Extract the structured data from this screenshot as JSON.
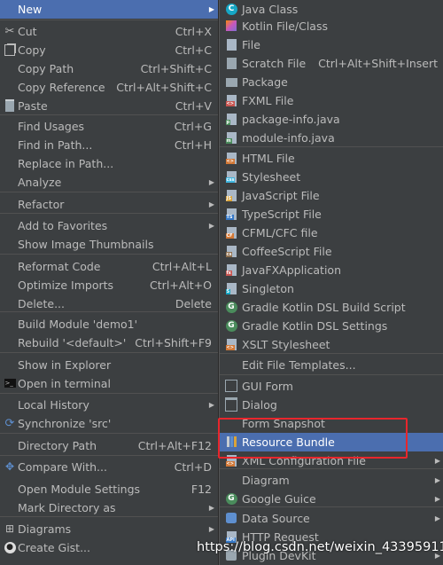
{
  "left_menu": {
    "items": [
      {
        "label": "New",
        "shortcut": "",
        "submenu": true,
        "icon": "",
        "selected": true
      },
      {
        "label": "Cut",
        "shortcut": "Ctrl+X",
        "submenu": false,
        "icon": "scissors-icon"
      },
      {
        "label": "Copy",
        "shortcut": "Ctrl+C",
        "submenu": false,
        "icon": "copy-icon"
      },
      {
        "label": "Copy Path",
        "shortcut": "Ctrl+Shift+C",
        "submenu": false,
        "icon": ""
      },
      {
        "label": "Copy Reference",
        "shortcut": "Ctrl+Alt+Shift+C",
        "submenu": false,
        "icon": ""
      },
      {
        "label": "Paste",
        "shortcut": "Ctrl+V",
        "submenu": false,
        "icon": "paste-icon"
      },
      {
        "label": "Find Usages",
        "shortcut": "Ctrl+G",
        "submenu": false,
        "icon": ""
      },
      {
        "label": "Find in Path...",
        "shortcut": "Ctrl+H",
        "submenu": false,
        "icon": ""
      },
      {
        "label": "Replace in Path...",
        "shortcut": "",
        "submenu": false,
        "icon": ""
      },
      {
        "label": "Analyze",
        "shortcut": "",
        "submenu": true,
        "icon": ""
      },
      {
        "label": "Refactor",
        "shortcut": "",
        "submenu": true,
        "icon": ""
      },
      {
        "label": "Add to Favorites",
        "shortcut": "",
        "submenu": true,
        "icon": ""
      },
      {
        "label": "Show Image Thumbnails",
        "shortcut": "",
        "submenu": false,
        "icon": ""
      },
      {
        "label": "Reformat Code",
        "shortcut": "Ctrl+Alt+L",
        "submenu": false,
        "icon": ""
      },
      {
        "label": "Optimize Imports",
        "shortcut": "Ctrl+Alt+O",
        "submenu": false,
        "icon": ""
      },
      {
        "label": "Delete...",
        "shortcut": "Delete",
        "submenu": false,
        "icon": ""
      },
      {
        "label": "Build Module 'demo1'",
        "shortcut": "",
        "submenu": false,
        "icon": ""
      },
      {
        "label": "Rebuild '<default>'",
        "shortcut": "Ctrl+Shift+F9",
        "submenu": false,
        "icon": ""
      },
      {
        "label": "Show in Explorer",
        "shortcut": "",
        "submenu": false,
        "icon": ""
      },
      {
        "label": "Open in terminal",
        "shortcut": "",
        "submenu": false,
        "icon": "terminal-icon"
      },
      {
        "label": "Local History",
        "shortcut": "",
        "submenu": true,
        "icon": ""
      },
      {
        "label": "Synchronize 'src'",
        "shortcut": "",
        "submenu": false,
        "icon": "sync-icon"
      },
      {
        "label": "Directory Path",
        "shortcut": "Ctrl+Alt+F12",
        "submenu": false,
        "icon": ""
      },
      {
        "label": "Compare With...",
        "shortcut": "Ctrl+D",
        "submenu": false,
        "icon": "compare-icon"
      },
      {
        "label": "Open Module Settings",
        "shortcut": "F12",
        "submenu": false,
        "icon": ""
      },
      {
        "label": "Mark Directory as",
        "shortcut": "",
        "submenu": true,
        "icon": ""
      },
      {
        "label": "Diagrams",
        "shortcut": "",
        "submenu": true,
        "icon": "diagrams-icon"
      },
      {
        "label": "Create Gist...",
        "shortcut": "",
        "submenu": false,
        "icon": "github-icon"
      }
    ]
  },
  "right_menu": {
    "items": [
      {
        "label": "Java Class",
        "shortcut": "",
        "submenu": false,
        "icon": "java-class-icon"
      },
      {
        "label": "Kotlin File/Class",
        "shortcut": "",
        "submenu": false,
        "icon": "kotlin-file-icon"
      },
      {
        "label": "File",
        "shortcut": "",
        "submenu": false,
        "icon": "file-icon"
      },
      {
        "label": "Scratch File",
        "shortcut": "Ctrl+Alt+Shift+Insert",
        "submenu": false,
        "icon": "scratch-file-icon"
      },
      {
        "label": "Package",
        "shortcut": "",
        "submenu": false,
        "icon": "package-icon"
      },
      {
        "label": "FXML File",
        "shortcut": "",
        "submenu": false,
        "icon": "fxml-file-icon"
      },
      {
        "label": "package-info.java",
        "shortcut": "",
        "submenu": false,
        "icon": "package-info-icon"
      },
      {
        "label": "module-info.java",
        "shortcut": "",
        "submenu": false,
        "icon": "module-info-icon"
      },
      {
        "label": "HTML File",
        "shortcut": "",
        "submenu": false,
        "icon": "html-file-icon"
      },
      {
        "label": "Stylesheet",
        "shortcut": "",
        "submenu": false,
        "icon": "css-file-icon"
      },
      {
        "label": "JavaScript File",
        "shortcut": "",
        "submenu": false,
        "icon": "js-file-icon"
      },
      {
        "label": "TypeScript File",
        "shortcut": "",
        "submenu": false,
        "icon": "ts-file-icon"
      },
      {
        "label": "CFML/CFC file",
        "shortcut": "",
        "submenu": false,
        "icon": "cfml-file-icon"
      },
      {
        "label": "CoffeeScript File",
        "shortcut": "",
        "submenu": false,
        "icon": "coffee-file-icon"
      },
      {
        "label": "JavaFXApplication",
        "shortcut": "",
        "submenu": false,
        "icon": "javafx-icon"
      },
      {
        "label": "Singleton",
        "shortcut": "",
        "submenu": false,
        "icon": "singleton-icon"
      },
      {
        "label": "Gradle Kotlin DSL Build Script",
        "shortcut": "",
        "submenu": false,
        "icon": "gradle-icon"
      },
      {
        "label": "Gradle Kotlin DSL Settings",
        "shortcut": "",
        "submenu": false,
        "icon": "gradle-icon"
      },
      {
        "label": "XSLT Stylesheet",
        "shortcut": "",
        "submenu": false,
        "icon": "xslt-icon"
      },
      {
        "label": "Edit File Templates...",
        "shortcut": "",
        "submenu": false,
        "icon": ""
      },
      {
        "label": "GUI Form",
        "shortcut": "",
        "submenu": false,
        "icon": "gui-form-icon"
      },
      {
        "label": "Dialog",
        "shortcut": "",
        "submenu": false,
        "icon": "dialog-icon"
      },
      {
        "label": "Form Snapshot",
        "shortcut": "",
        "submenu": false,
        "icon": ""
      },
      {
        "label": "Resource Bundle",
        "shortcut": "",
        "submenu": false,
        "icon": "resource-bundle-icon",
        "selected": true
      },
      {
        "label": "XML Configuration File",
        "shortcut": "",
        "submenu": true,
        "icon": "xml-file-icon"
      },
      {
        "label": "Diagram",
        "shortcut": "",
        "submenu": true,
        "icon": ""
      },
      {
        "label": "Google Guice",
        "shortcut": "",
        "submenu": true,
        "icon": "guice-icon"
      },
      {
        "label": "Data Source",
        "shortcut": "",
        "submenu": true,
        "icon": "datasource-icon"
      },
      {
        "label": "HTTP Request",
        "shortcut": "",
        "submenu": false,
        "icon": "http-request-icon"
      },
      {
        "label": "Plugin DevKit",
        "shortcut": "",
        "submenu": true,
        "icon": "plugin-icon"
      }
    ]
  },
  "watermark": "https://blog.csdn.net/weixin_43395911",
  "colors": {
    "selection": "#4b6eaf",
    "highlight": "#e8262c",
    "background": "#3c3f41"
  }
}
